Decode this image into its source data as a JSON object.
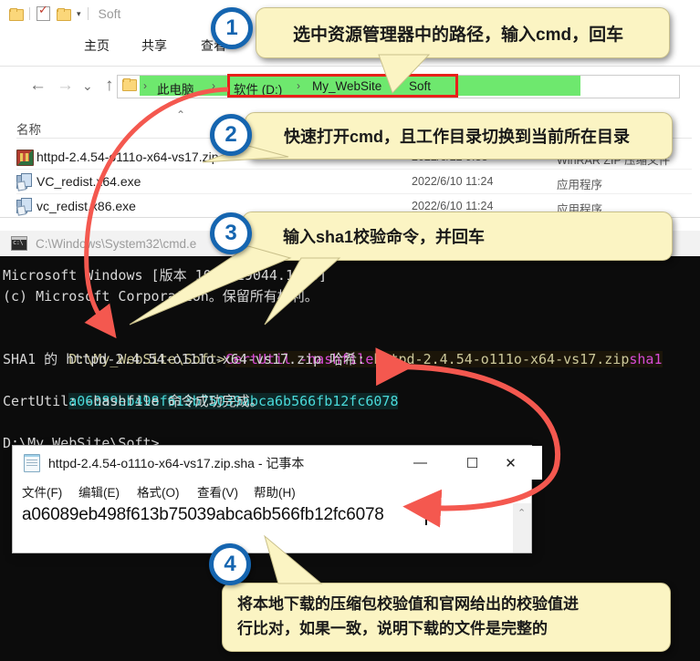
{
  "explorer": {
    "quick_access": {
      "title": "Soft",
      "icons": [
        "folder-icon",
        "checkbox-properties-icon",
        "new-folder-icon",
        "dropdown-caret-icon"
      ]
    },
    "ribbon_tabs": [
      {
        "label": "主页"
      },
      {
        "label": "共享"
      },
      {
        "label": "查看"
      }
    ],
    "nav": {
      "back": "←",
      "forward": "→",
      "recent": "⌄",
      "up": "↑"
    },
    "breadcrumb": {
      "items": [
        "此电脑",
        "软件 (D:)",
        "My_WebSite",
        "Soft"
      ],
      "separator": "›",
      "highlight_color": "#6ee86e",
      "selection_box_color": "#e8201a"
    },
    "columns": [
      {
        "label": "名称"
      },
      {
        "label": ""
      },
      {
        "label": ""
      }
    ],
    "files": [
      {
        "name": "httpd-2.4.54-o111o-x64-vs17.zip",
        "date": "2022/6/22 9:33",
        "type": "WinRAR ZIP 压缩文件",
        "icon": "zip-file-icon"
      },
      {
        "name": "VC_redist.x64.exe",
        "date": "2022/6/10 11:24",
        "type": "应用程序",
        "icon": "exe-file-icon"
      },
      {
        "name": "vc_redist.x86.exe",
        "date": "2022/6/10 11:24",
        "type": "应用程序",
        "icon": "exe-file-icon"
      }
    ]
  },
  "cmd": {
    "title": "C:\\Windows\\System32\\cmd.e",
    "lines": {
      "l1": "Microsoft Windows [版本 10.0.19044.1766]",
      "l2": "(c) Microsoft Corporation。保留所有权利。",
      "prompt1": "D:\\My_WebSite\\Soft>",
      "command": "CertUtil -hashfile",
      "arg_file": "httpd-2.4.54-o111o-x64-vs17.zip",
      "arg_algo": "sha1",
      "l4": "SHA1 的 httpd-2.4.54-o111o-x64-vs17.zip 哈希:",
      "hash": "a06089eb498f613b75039abca6b566fb12fc6078",
      "l6": "CertUtil: -hashfile 命令成功完成。",
      "prompt2": "D:\\My_WebSite\\Soft>"
    },
    "colors": {
      "background": "#0c0c0c",
      "text": "#d6d6d6",
      "command": "#d94bd6",
      "argument": "#ccc89a",
      "hash": "#49d9d9"
    }
  },
  "notepad": {
    "title": "httpd-2.4.54-o111o-x64-vs17.zip.sha - 记事本",
    "window_buttons": {
      "minimize": "—",
      "maximize": "☐",
      "close": "✕"
    },
    "menu": [
      {
        "label": "文件(F)"
      },
      {
        "label": "编辑(E)"
      },
      {
        "label": "格式(O)"
      },
      {
        "label": "查看(V)"
      },
      {
        "label": "帮助(H)"
      }
    ],
    "content": "a06089eb498f613b75039abca6b566fb12fc6078",
    "scroll_up": "⌃"
  },
  "callouts": [
    {
      "number": "1",
      "text": "选中资源管理器中的路径，输入cmd，回车"
    },
    {
      "number": "2",
      "text": "快速打开cmd，且工作目录切换到当前所在目录"
    },
    {
      "number": "3",
      "text": "输入sha1校验命令，并回车"
    },
    {
      "number": "4",
      "line1": "将本地下载的压缩包校验值和官网给出的校验值进",
      "line2": "行比对，如果一致，说明下载的文件是完整的"
    }
  ],
  "annotation_colors": {
    "callout_fill": "#fbf4c3",
    "callout_border": "#c9c08b",
    "badge_border": "#1565b0",
    "arrow_red": "#f4584f"
  }
}
